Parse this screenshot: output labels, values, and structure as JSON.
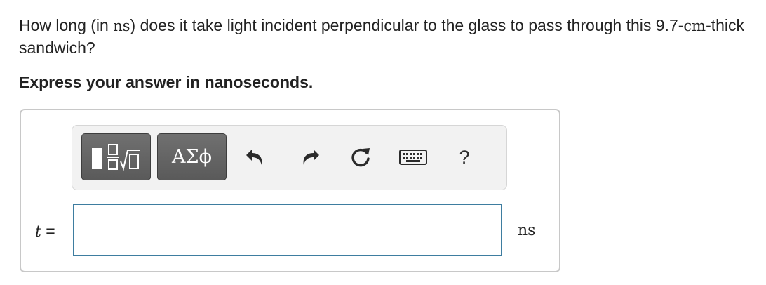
{
  "question": {
    "text_before": "How long (in ",
    "unit_inline": "ns",
    "text_middle": ") does it take light incident perpendicular to the glass to pass through this 9.7-",
    "thickness_unit": "cm",
    "text_after": "-thick sandwich?"
  },
  "instruction": "Express your answer in nanoseconds.",
  "toolbar": {
    "symbols_label": "ΑΣϕ",
    "help_label": "?",
    "icons": [
      "templates-icon",
      "symbols-icon",
      "undo-icon",
      "redo-icon",
      "reset-icon",
      "keyboard-icon",
      "help-icon"
    ]
  },
  "answer": {
    "variable": "t",
    "equals": " =",
    "value": "",
    "unit": "ns"
  },
  "colors": {
    "toolbar_button_bg": "#636363",
    "input_border": "#3e7da0",
    "box_border": "#c8c8c8"
  }
}
